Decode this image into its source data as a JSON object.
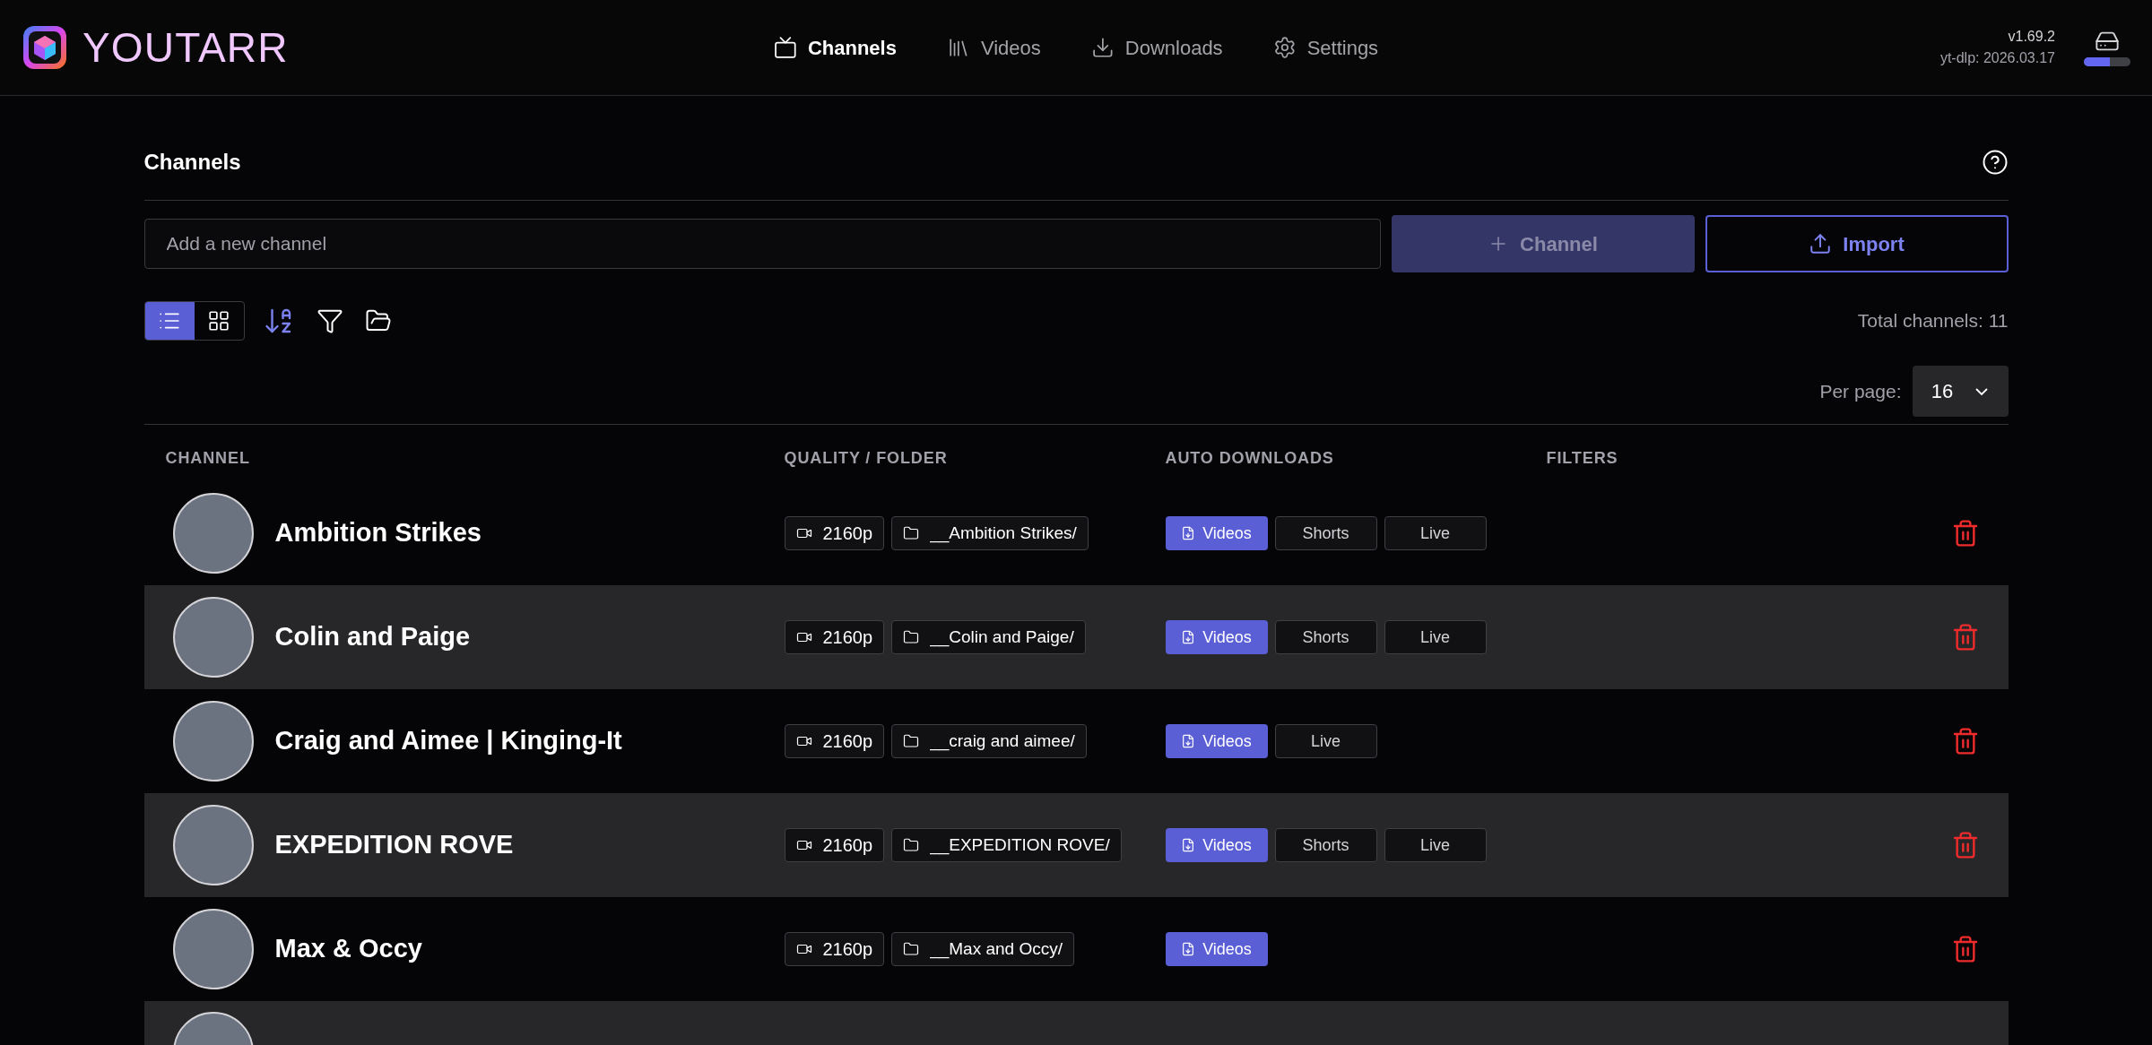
{
  "app": {
    "name": "YOUTARR",
    "version": "v1.69.2",
    "ytdlp": "yt-dlp: 2026.03.17",
    "storage": {
      "level": 0.55
    }
  },
  "nav": [
    {
      "label": "Channels",
      "kind": "tv",
      "selected": true
    },
    {
      "label": "Videos",
      "kind": "library",
      "selected": false
    },
    {
      "label": "Downloads",
      "kind": "download",
      "selected": false
    },
    {
      "label": "Settings",
      "kind": "settings",
      "selected": false
    }
  ],
  "page": {
    "title": "Channels",
    "add_channel": {
      "placeholder": "Add a new channel",
      "button": "Channel",
      "import": "Import"
    },
    "view_modes": [
      {
        "kind": "list",
        "selected": true
      },
      {
        "kind": "grid",
        "selected": false
      }
    ],
    "total": "Total channels: 11",
    "per_page_label": "Per page:",
    "per_page": "16"
  },
  "table": {
    "columns": [
      "CHANNEL",
      "QUALITY / FOLDER",
      "AUTO DOWNLOADS",
      "FILTERS"
    ],
    "rows": [
      {
        "name": "Ambition Strikes",
        "quality": "2160p",
        "folder": "__Ambition Strikes/",
        "downloads": [
          {
            "label": "Videos",
            "enabled": true
          },
          {
            "label": "Shorts",
            "enabled": false
          },
          {
            "label": "Live",
            "enabled": false
          }
        ]
      },
      {
        "name": "Colin and Paige",
        "quality": "2160p",
        "folder": "__Colin and Paige/",
        "downloads": [
          {
            "label": "Videos",
            "enabled": true
          },
          {
            "label": "Shorts",
            "enabled": false
          },
          {
            "label": "Live",
            "enabled": false
          }
        ]
      },
      {
        "name": "Craig and Aimee | Kinging-It",
        "quality": "2160p",
        "folder": "__craig and aimee/",
        "downloads": [
          {
            "label": "Videos",
            "enabled": true
          },
          {
            "label": "Live",
            "enabled": false
          }
        ]
      },
      {
        "name": "EXPEDITION ROVE",
        "quality": "2160p",
        "folder": "__EXPEDITION ROVE/",
        "downloads": [
          {
            "label": "Videos",
            "enabled": true
          },
          {
            "label": "Shorts",
            "enabled": false
          },
          {
            "label": "Live",
            "enabled": false
          }
        ]
      },
      {
        "name": "Max & Occy",
        "quality": "2160p",
        "folder": "__Max and Occy/",
        "downloads": [
          {
            "label": "Videos",
            "enabled": true
          }
        ]
      }
    ]
  }
}
